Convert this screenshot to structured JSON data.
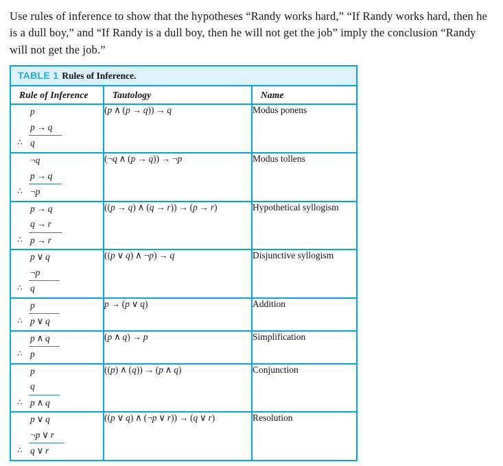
{
  "problem": {
    "text": "Use rules of inference to show that the hypotheses “Randy works hard,” “If Randy works hard, then he is a dull boy,” and “If Randy is a dull boy, then he will not get the job” imply the conclusion “Randy will not get the job.”"
  },
  "table": {
    "caption_label": "TABLE 1",
    "caption_title": "Rules of Inference.",
    "accent_color": "#00a6e6",
    "caption_bg": "#ddf2fc",
    "caption_label_color": "#29a8e0",
    "columns": [
      "Rule of Inference",
      "Tautology",
      "Name"
    ],
    "rows": [
      {
        "premises": [
          "p",
          "p → q"
        ],
        "conclusion": "q",
        "tautology": "(p ∧ (p → q)) → q",
        "name": "Modus ponens"
      },
      {
        "premises": [
          "¬q",
          "p → q"
        ],
        "conclusion": "¬p",
        "tautology": "(¬q ∧ (p → q)) → ¬p",
        "name": "Modus tollens"
      },
      {
        "premises": [
          "p → q",
          "q → r"
        ],
        "conclusion": "p → r",
        "tautology": "((p → q) ∧ (q → r)) → (p → r)",
        "name": "Hypothetical syllogism"
      },
      {
        "premises": [
          "p ∨ q",
          "¬p"
        ],
        "conclusion": "q",
        "tautology": "((p ∨ q) ∧ ¬p) → q",
        "name": "Disjunctive syllogism"
      },
      {
        "premises": [
          "p"
        ],
        "conclusion": "p ∨ q",
        "tautology": "p → (p ∨ q)",
        "name": "Addition"
      },
      {
        "premises": [
          "p ∧ q"
        ],
        "conclusion": "p",
        "tautology": "(p ∧ q) → p",
        "name": "Simplification"
      },
      {
        "premises": [
          "p",
          "q"
        ],
        "conclusion": "p ∧ q",
        "tautology": "((p) ∧ (q)) → (p ∧ q)",
        "name": "Conjunction"
      },
      {
        "premises": [
          "p ∨ q",
          "¬p ∨ r"
        ],
        "conclusion": "q ∨ r",
        "tautology": "((p ∨ q) ∧ (¬p ∨ r)) → (q ∨ r)",
        "name": "Resolution"
      }
    ],
    "therefore_symbol": "∴"
  }
}
